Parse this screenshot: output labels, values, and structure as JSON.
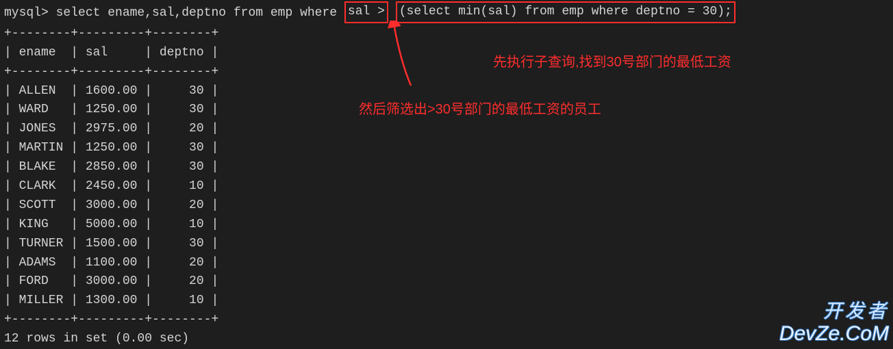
{
  "prompt": "mysql>",
  "query_part1": " select ename,sal,deptno from emp where ",
  "query_highlight1": "sal >",
  "query_spacer": " ",
  "query_highlight2": "(select min(sal) from emp where deptno = 30);",
  "border_top": "+--------+---------+--------+",
  "header_row": "| ename  | sal     | deptno |",
  "border_mid": "+--------+---------+--------+",
  "chart_data": {
    "type": "table",
    "columns": [
      "ename",
      "sal",
      "deptno"
    ],
    "rows": [
      {
        "ename": "ALLEN",
        "sal": "1600.00",
        "deptno": "30"
      },
      {
        "ename": "WARD",
        "sal": "1250.00",
        "deptno": "30"
      },
      {
        "ename": "JONES",
        "sal": "2975.00",
        "deptno": "20"
      },
      {
        "ename": "MARTIN",
        "sal": "1250.00",
        "deptno": "30"
      },
      {
        "ename": "BLAKE",
        "sal": "2850.00",
        "deptno": "30"
      },
      {
        "ename": "CLARK",
        "sal": "2450.00",
        "deptno": "10"
      },
      {
        "ename": "SCOTT",
        "sal": "3000.00",
        "deptno": "20"
      },
      {
        "ename": "KING",
        "sal": "5000.00",
        "deptno": "10"
      },
      {
        "ename": "TURNER",
        "sal": "1500.00",
        "deptno": "30"
      },
      {
        "ename": "ADAMS",
        "sal": "1100.00",
        "deptno": "20"
      },
      {
        "ename": "FORD",
        "sal": "3000.00",
        "deptno": "20"
      },
      {
        "ename": "MILLER",
        "sal": "1300.00",
        "deptno": "10"
      }
    ]
  },
  "border_bottom": "+--------+---------+--------+",
  "status": "12 rows in set (0.00 sec)",
  "annotation1": "先执行子查询,找到30号部门的最低工资",
  "annotation2": "然后筛选出>30号部门的最低工资的员工",
  "watermark_cn": "开发者",
  "watermark_en": "DevZe.CoM"
}
